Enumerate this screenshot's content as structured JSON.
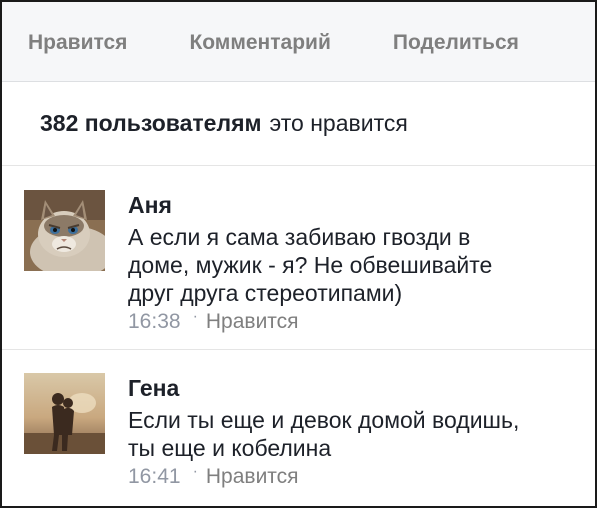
{
  "actions": {
    "like": "Нравится",
    "comment": "Комментарий",
    "share": "Поделиться"
  },
  "likes": {
    "count_text": "382 пользователям",
    "suffix": "это нравится"
  },
  "comments": [
    {
      "author": "Аня",
      "lines": [
        "А если я сама забиваю гвозди в",
        "доме, мужик - я? Не обвешивайте",
        "друг друга стереотипами)"
      ],
      "time": "16:38",
      "separator": "·",
      "like_label": "Нравится",
      "avatar_icon": "grumpy-cat-avatar"
    },
    {
      "author": "Гена",
      "lines": [
        "Если ты еще и девок домой водишь,",
        "ты еще и кобелина"
      ],
      "time": "16:41",
      "separator": "·",
      "like_label": "Нравится",
      "avatar_icon": "couple-sunset-avatar"
    }
  ]
}
